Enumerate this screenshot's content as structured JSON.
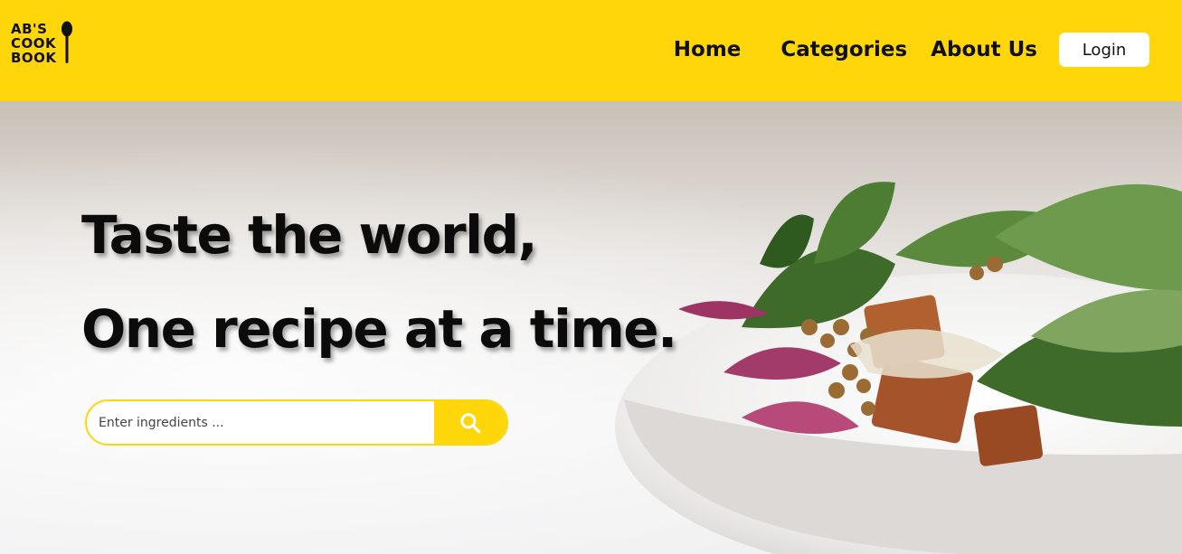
{
  "header": {
    "logo": {
      "lines": [
        "AB'S",
        "COOK",
        "BOOK"
      ],
      "icon": "spoon-icon"
    },
    "nav": {
      "home": "Home",
      "categories": "Categories",
      "about": "About Us",
      "login": "Login"
    },
    "color": "#FFD60A"
  },
  "hero": {
    "headline_line1": "Taste the world,",
    "headline_line2": "One recipe at a time.",
    "search": {
      "placeholder": "Enter ingredients ...",
      "value": "",
      "button_icon": "search-icon"
    }
  },
  "colors": {
    "accent": "#FFD60A",
    "text": "#0b0b0b",
    "white": "#ffffff"
  }
}
